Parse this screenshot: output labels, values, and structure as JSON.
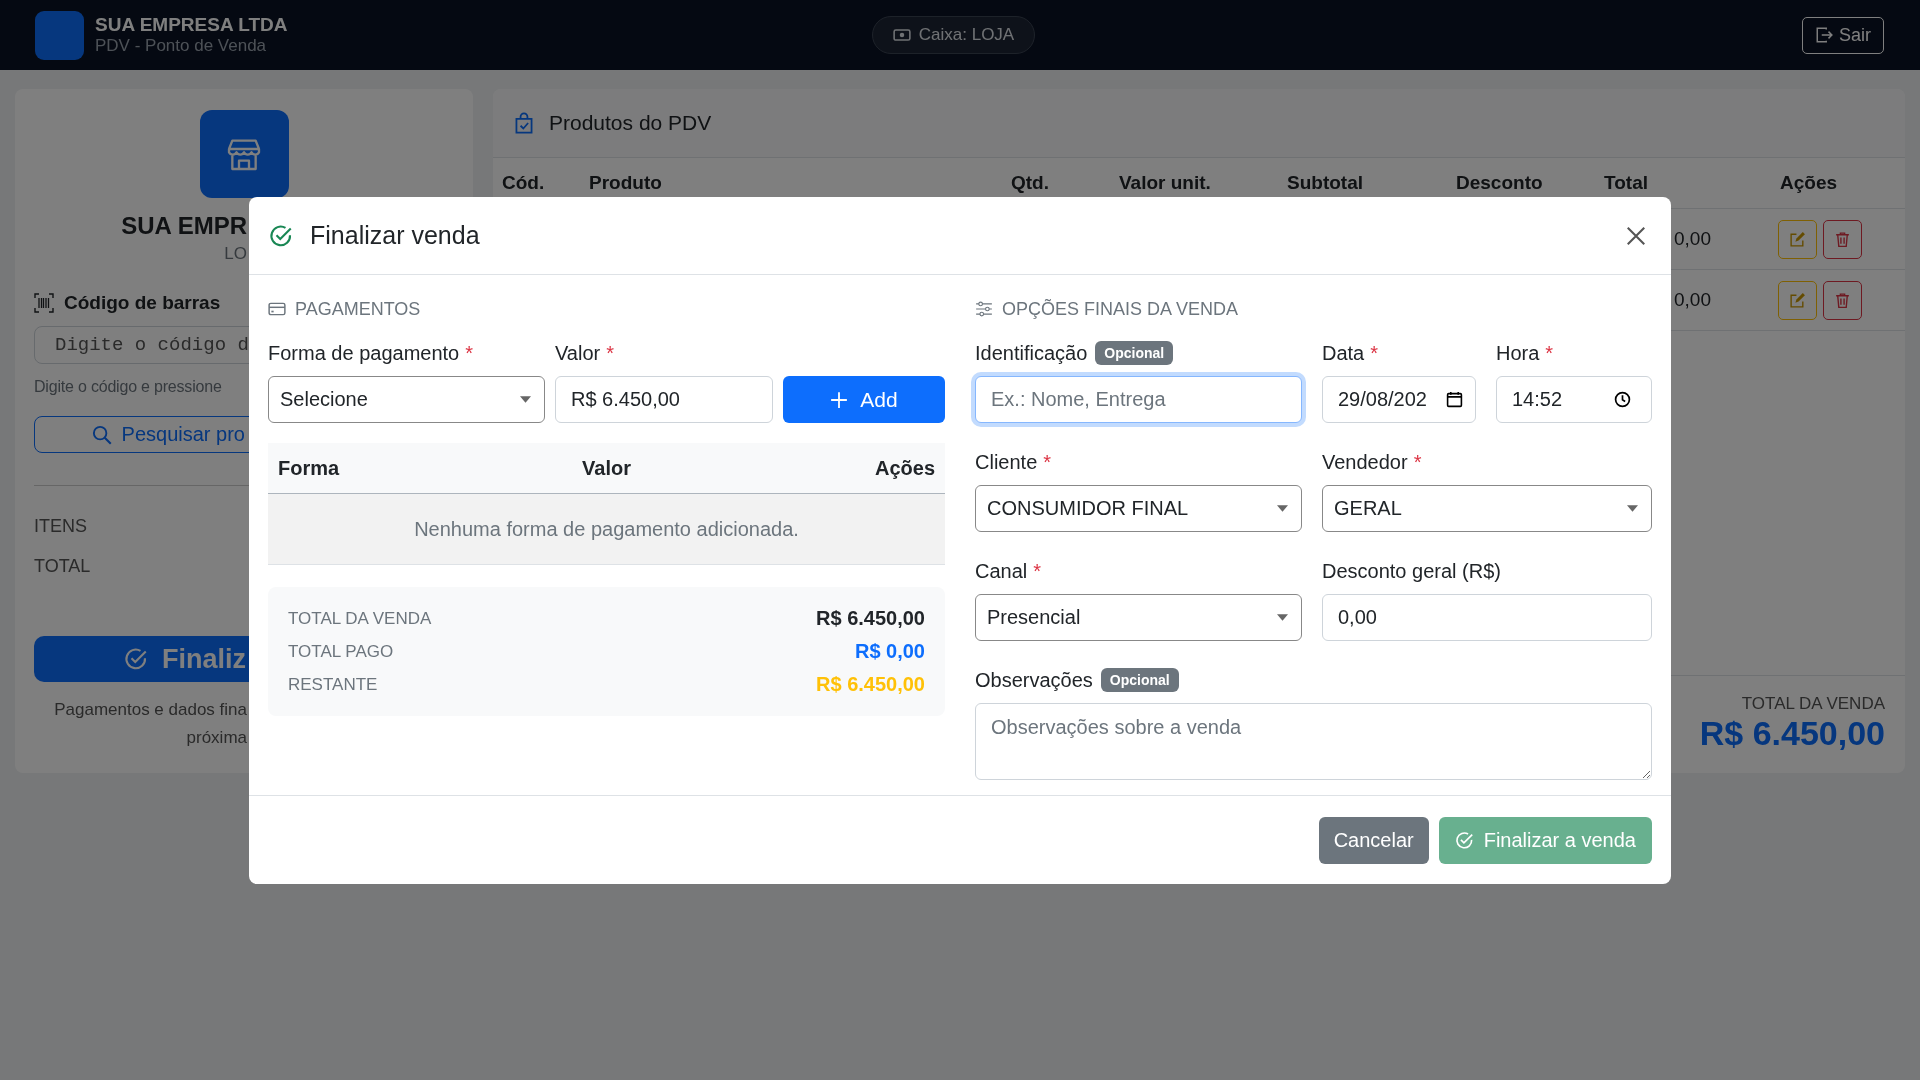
{
  "navbar": {
    "company": "SUA EMPRESA LTDA",
    "subtitle": "PDV - Ponto de Venda",
    "register": "Caixa: LOJA",
    "logout": "Sair"
  },
  "left_panel": {
    "company": "SUA EMPR",
    "store": "LO",
    "barcode_label": "Código de barras",
    "barcode_placeholder": "Digite o código d",
    "hint": "Digite o código e pressione",
    "search_button": "Pesquisar pro",
    "summary": [
      {
        "label": "ITENS"
      },
      {
        "label": "TOTAL"
      }
    ],
    "finish_button": "Finaliz",
    "note": "Pagamentos e dados fina\npróxima"
  },
  "products_panel": {
    "title": "Produtos do PDV",
    "columns": [
      "Cód.",
      "Produto",
      "Qtd.",
      "Valor unit.",
      "Subtotal",
      "Desconto",
      "Total",
      "Ações"
    ],
    "rows": [
      {
        "total": "0,00"
      },
      {
        "total": "0,00"
      }
    ],
    "total_label": "TOTAL DA VENDA",
    "total_value": "R$ 6.450,00"
  },
  "modal": {
    "title": "Finalizar venda",
    "payments": {
      "heading": "PAGAMENTOS",
      "method_label": "Forma de pagamento",
      "method_mark": "*",
      "method_value": "Selecione",
      "amount_label": "Valor",
      "amount_mark": "*",
      "amount_value": "R$ 6.450,00",
      "add_button": "Add",
      "columns": [
        "Forma",
        "Valor",
        "Ações"
      ],
      "empty": "Nenhuma forma de pagamento adicionada.",
      "summary": [
        {
          "label": "TOTAL DA VENDA",
          "value": "R$ 6.450,00",
          "color": "#212529"
        },
        {
          "label": "TOTAL PAGO",
          "value": "R$ 0,00",
          "color": "#0d6efd"
        },
        {
          "label": "RESTANTE",
          "value": "R$ 6.450,00",
          "color": "#ffc107"
        }
      ]
    },
    "options": {
      "heading": "OPÇÕES FINAIS DA VENDA",
      "fields": [
        {
          "kind": "text",
          "label": "Identificação",
          "badge": "Opcional",
          "placeholder": "Ex.: Nome, Entrega",
          "focused": true
        },
        {
          "kind": "date",
          "label": "Data",
          "mark": "*",
          "value": "29/08/202"
        },
        {
          "kind": "time",
          "label": "Hora",
          "mark": "*",
          "value": "14:52"
        },
        {
          "kind": "select",
          "label": "Cliente",
          "mark": "*",
          "value": "CONSUMIDOR FINAL"
        },
        {
          "kind": "select",
          "label": "Vendedor",
          "mark": "*",
          "value": "GERAL"
        },
        {
          "kind": "select",
          "label": "Canal",
          "mark": "*",
          "value": "Presencial"
        },
        {
          "kind": "text",
          "label": "Desconto geral (R$)",
          "value": "0,00",
          "focused": false
        },
        {
          "kind": "textarea",
          "label": "Observações",
          "badge": "Opcional",
          "placeholder": "Observações sobre a venda"
        }
      ]
    },
    "footer": {
      "cancel": "Cancelar",
      "confirm": {
        "label": "Finalizar a venda",
        "disabled": true
      }
    }
  }
}
